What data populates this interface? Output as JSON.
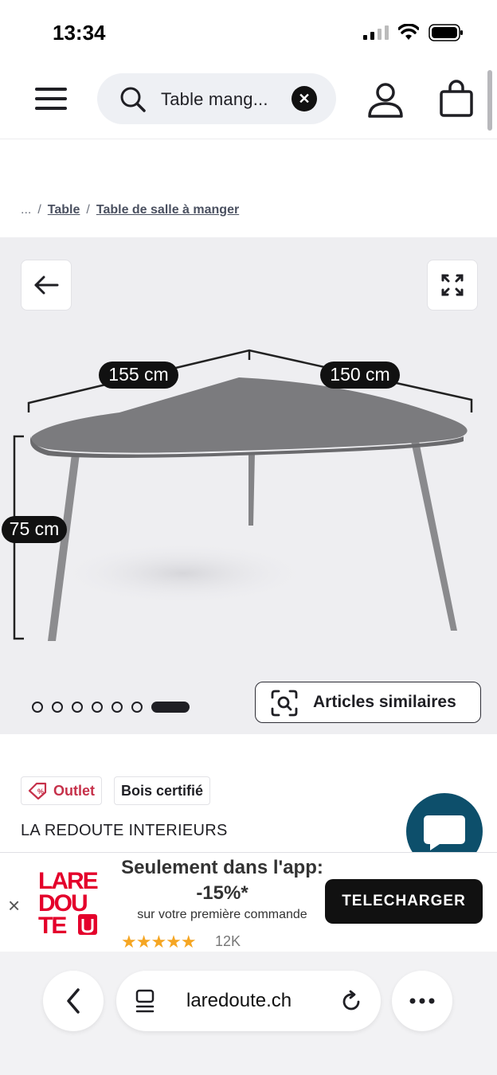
{
  "status_bar": {
    "time": "13:34"
  },
  "header": {
    "search_value": "Table mang...",
    "icons": [
      "menu-icon",
      "search-icon",
      "clear-icon",
      "account-icon",
      "cart-icon"
    ]
  },
  "breadcrumb": {
    "ellipsis": "...",
    "items": [
      "Table",
      "Table de salle à manger"
    ]
  },
  "gallery": {
    "dimensions": [
      "155 cm",
      "150 cm",
      "75 cm"
    ],
    "similar_label": "Articles similaires",
    "total_images": 7,
    "active_image": 7
  },
  "product": {
    "badges": [
      "Outlet",
      "Bois certifié"
    ],
    "brand": "LA REDOUTE INTERIEURS"
  },
  "app_banner": {
    "logo_lines": [
      "LARE",
      "DOU",
      "TE"
    ],
    "title": "Seulement dans l'app: -15%*",
    "subtitle": "sur votre première commande",
    "stars": "★★★★★",
    "rating_count": "12K",
    "cta": "TELECHARGER",
    "close": "×"
  },
  "browser": {
    "url": "laredoute.ch"
  },
  "colors": {
    "accent_dark": "#1f1f24",
    "outlet_red": "#c6314a",
    "chat_blue": "#0d4f6b",
    "star": "#f5a623"
  }
}
